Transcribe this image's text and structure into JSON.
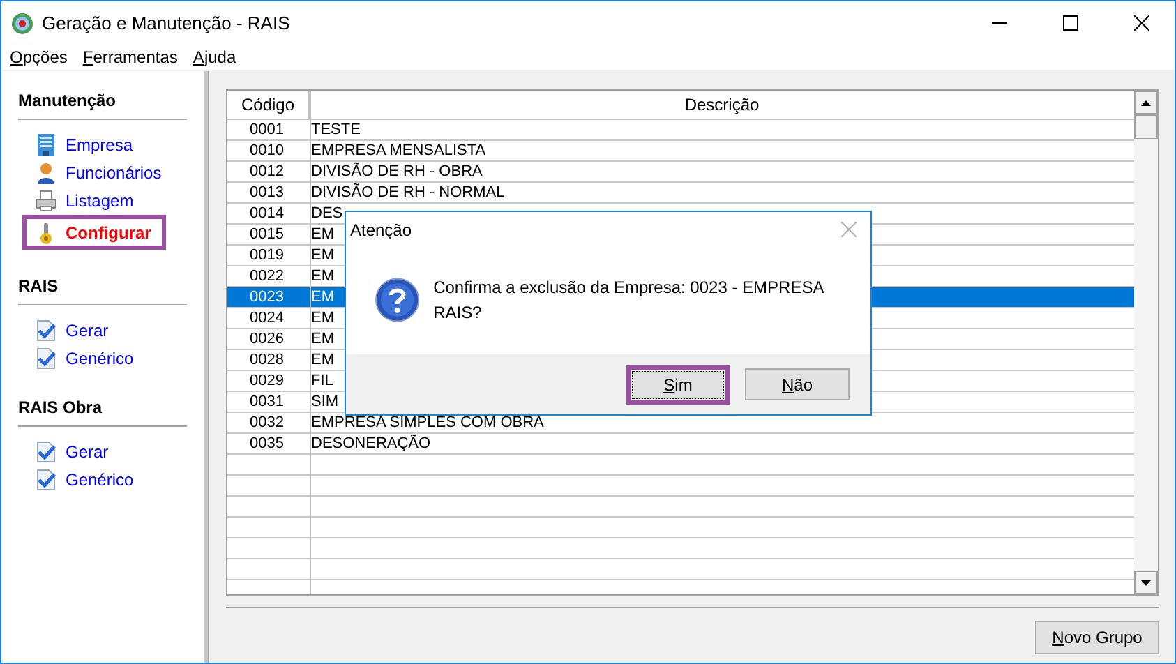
{
  "window": {
    "title": "Geração e Manutenção - RAIS"
  },
  "menu": [
    {
      "label": "Opções"
    },
    {
      "label": "Ferramentas"
    },
    {
      "label": "Ajuda"
    }
  ],
  "sidebar": [
    {
      "heading": "Manutenção",
      "items": [
        {
          "label": "Empresa",
          "kind": "building",
          "highlighted": false
        },
        {
          "label": "Funcionários",
          "kind": "person",
          "highlighted": false
        },
        {
          "label": "Listagem",
          "kind": "printer",
          "highlighted": false
        },
        {
          "label": "Configurar",
          "kind": "config",
          "highlighted": true
        }
      ]
    },
    {
      "heading": "RAIS",
      "items": [
        {
          "label": "Gerar",
          "kind": "check",
          "highlighted": false
        },
        {
          "label": "Genérico",
          "kind": "check",
          "highlighted": false
        }
      ]
    },
    {
      "heading": "RAIS Obra",
      "items": [
        {
          "label": "Gerar",
          "kind": "check",
          "highlighted": false
        },
        {
          "label": "Genérico",
          "kind": "check",
          "highlighted": false
        }
      ]
    }
  ],
  "table": {
    "columns": [
      "Código",
      "Descrição"
    ],
    "rows": [
      {
        "code": "0001",
        "description": "TESTE",
        "selected": false
      },
      {
        "code": "0010",
        "description": "EMPRESA MENSALISTA",
        "selected": false
      },
      {
        "code": "0012",
        "description": "DIVISÃO DE RH - OBRA",
        "selected": false
      },
      {
        "code": "0013",
        "description": "DIVISÃO DE RH - NORMAL",
        "selected": false
      },
      {
        "code": "0014",
        "description": "DES",
        "selected": false
      },
      {
        "code": "0015",
        "description": "EM",
        "selected": false
      },
      {
        "code": "0019",
        "description": "EM",
        "selected": false
      },
      {
        "code": "0022",
        "description": "EM",
        "selected": false
      },
      {
        "code": "0023",
        "description": "EM",
        "selected": true
      },
      {
        "code": "0024",
        "description": "EM",
        "selected": false
      },
      {
        "code": "0026",
        "description": "EM",
        "selected": false
      },
      {
        "code": "0028",
        "description": "EM",
        "selected": false
      },
      {
        "code": "0029",
        "description": "FIL",
        "selected": false
      },
      {
        "code": "0031",
        "description": "SIM",
        "selected": false
      },
      {
        "code": "0032",
        "description": "EMPRESA SIMPLES COM OBRA",
        "selected": false
      },
      {
        "code": "0035",
        "description": "DESONERAÇÃO",
        "selected": false
      }
    ]
  },
  "footer_button": {
    "label": "Novo Grupo"
  },
  "dialog": {
    "title": "Atenção",
    "message": "Confirma a exclusão da Empresa: 0023 - EMPRESA RAIS?",
    "buttons": [
      {
        "label": "Sim",
        "highlighted": true
      },
      {
        "label": "Não",
        "highlighted": false
      }
    ]
  }
}
